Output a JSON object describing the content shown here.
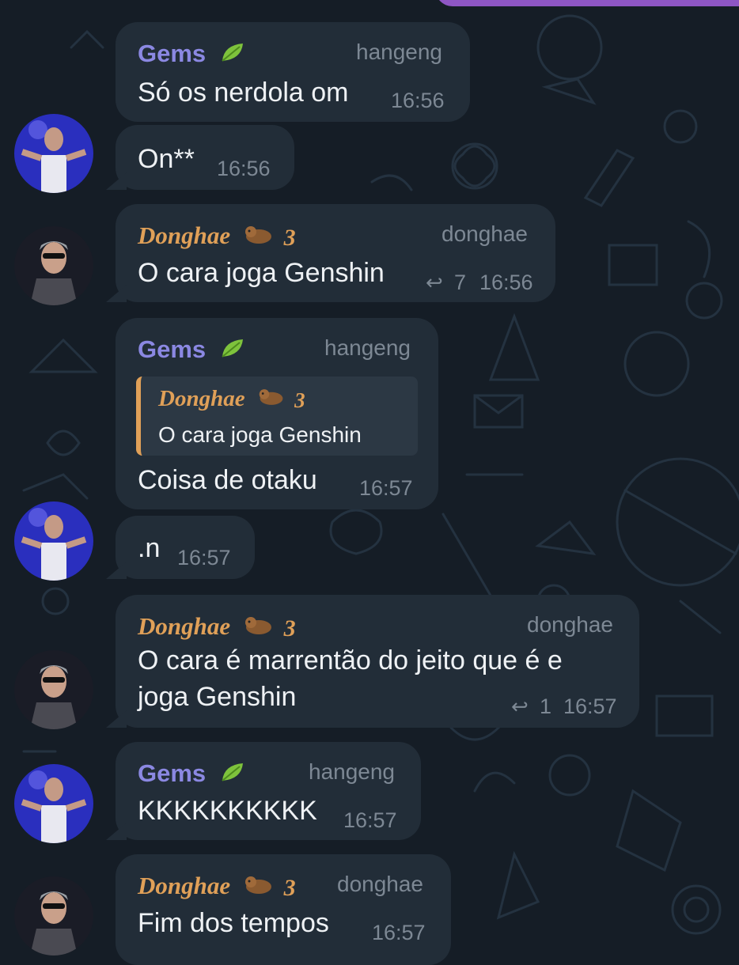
{
  "chat": {
    "messages": [
      {
        "sender": "Gems",
        "handle": "hangeng",
        "text": "Só os nerdola om",
        "time": "16:56"
      },
      {
        "text": "On**",
        "time": "16:56"
      },
      {
        "sender": "Donghae",
        "handle": "donghae",
        "text": "O cara joga Genshin",
        "replies": "7",
        "time": "16:56"
      },
      {
        "sender": "Gems",
        "handle": "hangeng",
        "quote": {
          "sender": "Donghae",
          "text": "O cara joga Genshin"
        },
        "text": "Coisa de otaku",
        "time": "16:57"
      },
      {
        "text": ".n",
        "time": "16:57"
      },
      {
        "sender": "Donghae",
        "handle": "donghae",
        "text_line1": "O cara é marrentão do jeito que é e",
        "text_line2": "joga Genshin",
        "replies": "1",
        "time": "16:57"
      },
      {
        "sender": "Gems",
        "handle": "hangeng",
        "text": "KKKKKKKKKK",
        "time": "16:57"
      },
      {
        "sender": "Donghae",
        "handle": "donghae",
        "text": "Fim dos tempos",
        "time": "16:57"
      }
    ],
    "badge_digit": "3",
    "icons": {
      "gems_badge": "leaf-icon",
      "donghae_badge": "otter-icon",
      "reply": "reply-arrow-icon"
    },
    "colors": {
      "background": "#151d26",
      "bubble": "#222d38",
      "gems_name": "#8b88e2",
      "donghae_name": "#e0a058",
      "meta": "#7d8894",
      "outgoing": "#8e56c4"
    }
  }
}
